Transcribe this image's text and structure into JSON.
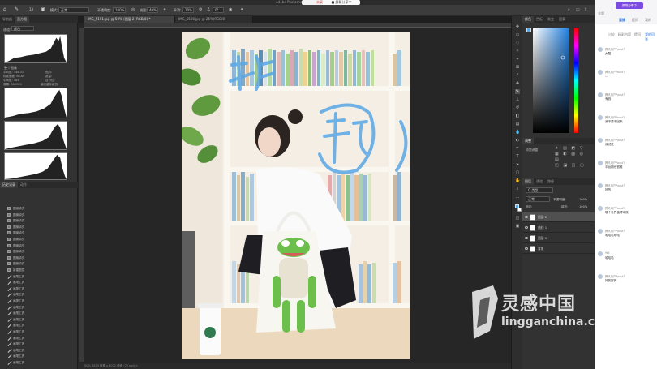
{
  "titlebar": {
    "title": "Adobe Photoshop",
    "recording_tab": "未录制",
    "share_tab": "■ 屏幕分享中"
  },
  "options": {
    "brush_size": "13",
    "mode_label": "模式:",
    "mode_value": "正常",
    "opacity_label": "不透明度:",
    "opacity_value": "100%",
    "flow_label": "流量:",
    "flow_value": "40%",
    "smooth_label": "平滑:",
    "smooth_value": "10%",
    "angle_value": "0°"
  },
  "doc_tabs": [
    {
      "label": "IMG_5191.jpg @ 50% (图层 2, RGB/8) *",
      "active": true
    },
    {
      "label": "IMG_5528.jpg @ 25%(RGB/8)",
      "active": false
    }
  ],
  "left_panel": {
    "tabs": [
      "导航器",
      "直方图"
    ],
    "channel_label": "通道:",
    "channel_value": "颜色",
    "layer_label": "整个图像",
    "stats": [
      {
        "k": "平均值:",
        "v": "148.31"
      },
      {
        "k": "标准偏差:",
        "v": "66.60"
      },
      {
        "k": "中间值:",
        "v": "165"
      },
      {
        "k": "像素:",
        "v": "360900"
      }
    ],
    "stats_right": [
      "色阶:",
      "数量:",
      "百分位:",
      "高速缓存级别:"
    ],
    "history_tabs": [
      "历史记录",
      "动作"
    ],
    "history_items": [
      {
        "label": "图案填充",
        "type": "fill"
      },
      {
        "label": "图案填充",
        "type": "fill"
      },
      {
        "label": "图案填充",
        "type": "fill"
      },
      {
        "label": "图案填充",
        "type": "fill"
      },
      {
        "label": "图案填充",
        "type": "fill"
      },
      {
        "label": "图案填充",
        "type": "fill"
      },
      {
        "label": "图案填充",
        "type": "fill"
      },
      {
        "label": "图案填充",
        "type": "fill"
      },
      {
        "label": "图案填充",
        "type": "fill"
      },
      {
        "label": "图案填充",
        "type": "fill"
      },
      {
        "label": "新建图层",
        "type": "fill"
      },
      {
        "label": "画笔工具",
        "type": "brush"
      },
      {
        "label": "画笔工具",
        "type": "brush"
      },
      {
        "label": "画笔工具",
        "type": "brush"
      },
      {
        "label": "画笔工具",
        "type": "brush"
      },
      {
        "label": "画笔工具",
        "type": "brush"
      },
      {
        "label": "画笔工具",
        "type": "brush"
      },
      {
        "label": "画笔工具",
        "type": "brush"
      },
      {
        "label": "画笔工具",
        "type": "brush"
      },
      {
        "label": "画笔工具",
        "type": "brush"
      },
      {
        "label": "画笔工具",
        "type": "brush"
      },
      {
        "label": "画笔工具",
        "type": "brush"
      },
      {
        "label": "画笔工具",
        "type": "brush"
      },
      {
        "label": "画笔工具",
        "type": "brush"
      },
      {
        "label": "画笔工具",
        "type": "brush"
      },
      {
        "label": "画笔工具",
        "type": "brush"
      }
    ]
  },
  "statusbar": {
    "text": "50%    3024 像素 x 4032 像素 (72 ppi)    >"
  },
  "right_panel": {
    "color_tabs": [
      "颜色",
      "色板",
      "渐变",
      "图案"
    ],
    "adjust_tabs": [
      "调整"
    ],
    "adjust_label": "添加调整",
    "layer_tabs": [
      "图层",
      "通道",
      "路径"
    ],
    "kind_label": "Q 类型",
    "blend_mode": "正常",
    "opacity_label": "不透明度:",
    "opacity_value": "100%",
    "lock_label": "锁定:",
    "fill_label": "填充:",
    "fill_value": "100%",
    "layers": [
      {
        "name": "图层 2",
        "selected": true
      },
      {
        "name": "曲线 1",
        "selected": false
      },
      {
        "name": "图层 1",
        "selected": false
      },
      {
        "name": "背景",
        "selected": false
      }
    ]
  },
  "chat": {
    "badge": "屏幕分享中",
    "tabs": [
      "全部",
      "直播",
      "提问",
      "我的"
    ],
    "sub_tabs": [
      "讨论",
      "精彩内容",
      "提问",
      "我的回答"
    ],
    "messages": [
      {
        "name": "腾讯用户Paust7",
        "text": "太酷"
      },
      {
        "name": "腾讯用户Paust7",
        "text": "..."
      },
      {
        "name": "腾讯用户Paust7",
        "text": "有钱"
      },
      {
        "name": "腾讯用户Paust7",
        "text": "我不要不回来"
      },
      {
        "name": "腾讯用户Paust7",
        "text": "我试过"
      },
      {
        "name": "腾讯用户Paust7",
        "text": "平台期也很难"
      },
      {
        "name": "腾讯用户Paust7",
        "text": "好的"
      },
      {
        "name": "腾讯用户Paust7",
        "text": "哪个世界值得审核"
      },
      {
        "name": "腾讯用户Paust7",
        "text": "哈哈哈哈哈"
      },
      {
        "name": "Yell",
        "text": "哈哈哈"
      },
      {
        "name": "腾讯用户Paust7",
        "text": "好的好的"
      }
    ]
  },
  "watermark": {
    "brand": "灵感中国",
    "url": "lingganchina.com"
  }
}
